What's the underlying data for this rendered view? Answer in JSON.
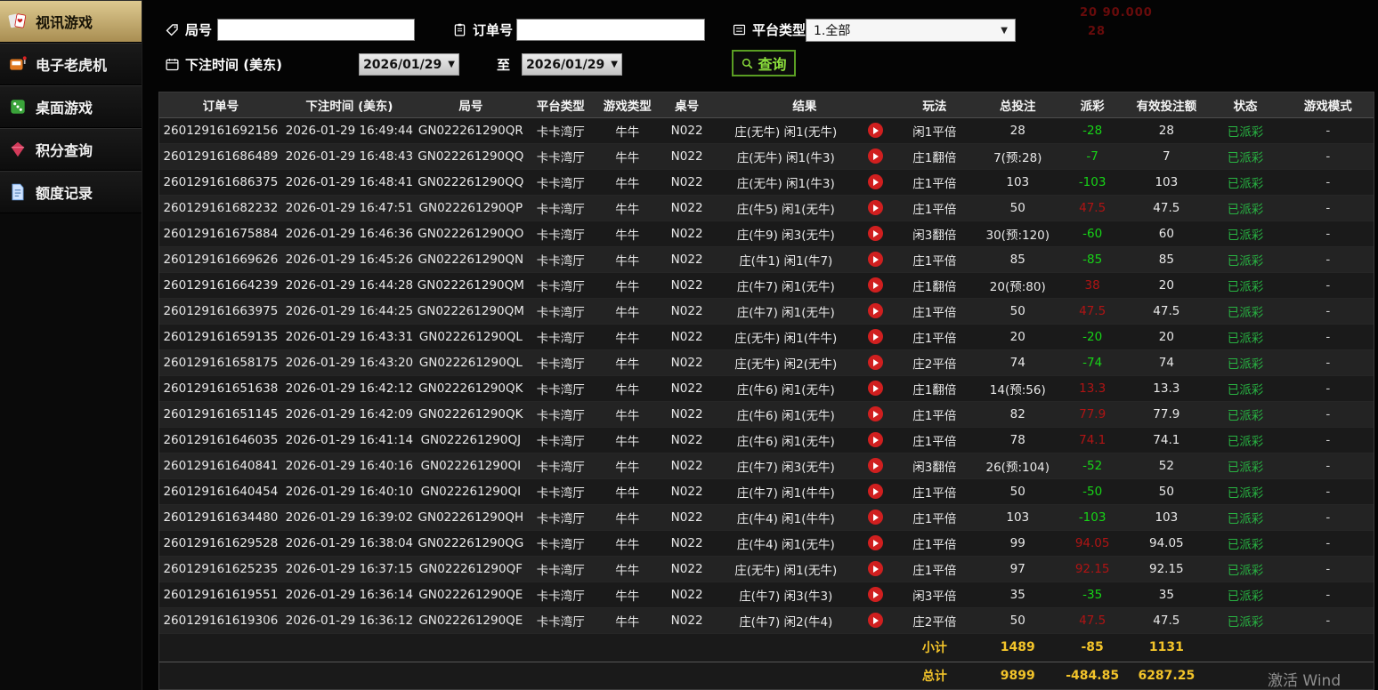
{
  "sidebar": {
    "items": [
      {
        "label": "视讯游戏",
        "active": true
      },
      {
        "label": "电子老虎机",
        "active": false
      },
      {
        "label": "桌面游戏",
        "active": false
      },
      {
        "label": "积分查询",
        "active": false
      },
      {
        "label": "额度记录",
        "active": false
      }
    ]
  },
  "filters": {
    "round_label": "局号",
    "round_value": "",
    "order_label": "订单号",
    "order_value": "",
    "platform_label": "平台类型",
    "platform_value": "1.全部",
    "bet_time_label": "下注时间 (美东)",
    "date_from": "2026/01/29",
    "to_label": "至",
    "date_to": "2026/01/29",
    "search_label": "查询"
  },
  "table": {
    "headers": [
      "订单号",
      "下注时间 (美东)",
      "局号",
      "平台类型",
      "游戏类型",
      "桌号",
      "结果",
      "玩法",
      "总投注",
      "派彩",
      "有效投注额",
      "状态",
      "游戏模式"
    ],
    "rows": [
      {
        "order_id": "260129161692156",
        "bet_time": "2026-01-29 16:49:44",
        "round_id": "GN022261290QR",
        "platform": "卡卡湾厅",
        "game_type": "牛牛",
        "table_no": "N022",
        "result": "庄(无牛) 闲1(无牛)",
        "play_type": "闲1平倍",
        "total_bet": "28",
        "payout": "-28",
        "payout_color": "green",
        "valid_bet": "28",
        "status": "已派彩",
        "mode": "-"
      },
      {
        "order_id": "260129161686489",
        "bet_time": "2026-01-29 16:48:43",
        "round_id": "GN022261290QQ",
        "platform": "卡卡湾厅",
        "game_type": "牛牛",
        "table_no": "N022",
        "result": "庄(无牛) 闲1(牛3)",
        "play_type": "庄1翻倍",
        "total_bet": "7(预:28)",
        "payout": "-7",
        "payout_color": "green",
        "valid_bet": "7",
        "status": "已派彩",
        "mode": "-"
      },
      {
        "order_id": "260129161686375",
        "bet_time": "2026-01-29 16:48:41",
        "round_id": "GN022261290QQ",
        "platform": "卡卡湾厅",
        "game_type": "牛牛",
        "table_no": "N022",
        "result": "庄(无牛) 闲1(牛3)",
        "play_type": "庄1平倍",
        "total_bet": "103",
        "payout": "-103",
        "payout_color": "green",
        "valid_bet": "103",
        "status": "已派彩",
        "mode": "-"
      },
      {
        "order_id": "260129161682232",
        "bet_time": "2026-01-29 16:47:51",
        "round_id": "GN022261290QP",
        "platform": "卡卡湾厅",
        "game_type": "牛牛",
        "table_no": "N022",
        "result": "庄(牛5) 闲1(无牛)",
        "play_type": "庄1平倍",
        "total_bet": "50",
        "payout": "47.5",
        "payout_color": "red",
        "valid_bet": "47.5",
        "status": "已派彩",
        "mode": "-"
      },
      {
        "order_id": "260129161675884",
        "bet_time": "2026-01-29 16:46:36",
        "round_id": "GN022261290QO",
        "platform": "卡卡湾厅",
        "game_type": "牛牛",
        "table_no": "N022",
        "result": "庄(牛9) 闲3(无牛)",
        "play_type": "闲3翻倍",
        "total_bet": "30(预:120)",
        "payout": "-60",
        "payout_color": "green",
        "valid_bet": "60",
        "status": "已派彩",
        "mode": "-"
      },
      {
        "order_id": "260129161669626",
        "bet_time": "2026-01-29 16:45:26",
        "round_id": "GN022261290QN",
        "platform": "卡卡湾厅",
        "game_type": "牛牛",
        "table_no": "N022",
        "result": "庄(牛1) 闲1(牛7)",
        "play_type": "庄1平倍",
        "total_bet": "85",
        "payout": "-85",
        "payout_color": "green",
        "valid_bet": "85",
        "status": "已派彩",
        "mode": "-"
      },
      {
        "order_id": "260129161664239",
        "bet_time": "2026-01-29 16:44:28",
        "round_id": "GN022261290QM",
        "platform": "卡卡湾厅",
        "game_type": "牛牛",
        "table_no": "N022",
        "result": "庄(牛7) 闲1(无牛)",
        "play_type": "庄1翻倍",
        "total_bet": "20(预:80)",
        "payout": "38",
        "payout_color": "red",
        "valid_bet": "20",
        "status": "已派彩",
        "mode": "-"
      },
      {
        "order_id": "260129161663975",
        "bet_time": "2026-01-29 16:44:25",
        "round_id": "GN022261290QM",
        "platform": "卡卡湾厅",
        "game_type": "牛牛",
        "table_no": "N022",
        "result": "庄(牛7) 闲1(无牛)",
        "play_type": "庄1平倍",
        "total_bet": "50",
        "payout": "47.5",
        "payout_color": "red",
        "valid_bet": "47.5",
        "status": "已派彩",
        "mode": "-"
      },
      {
        "order_id": "260129161659135",
        "bet_time": "2026-01-29 16:43:31",
        "round_id": "GN022261290QL",
        "platform": "卡卡湾厅",
        "game_type": "牛牛",
        "table_no": "N022",
        "result": "庄(无牛) 闲1(牛牛)",
        "play_type": "庄1平倍",
        "total_bet": "20",
        "payout": "-20",
        "payout_color": "green",
        "valid_bet": "20",
        "status": "已派彩",
        "mode": "-"
      },
      {
        "order_id": "260129161658175",
        "bet_time": "2026-01-29 16:43:20",
        "round_id": "GN022261290QL",
        "platform": "卡卡湾厅",
        "game_type": "牛牛",
        "table_no": "N022",
        "result": "庄(无牛) 闲2(无牛)",
        "play_type": "庄2平倍",
        "total_bet": "74",
        "payout": "-74",
        "payout_color": "green",
        "valid_bet": "74",
        "status": "已派彩",
        "mode": "-"
      },
      {
        "order_id": "260129161651638",
        "bet_time": "2026-01-29 16:42:12",
        "round_id": "GN022261290QK",
        "platform": "卡卡湾厅",
        "game_type": "牛牛",
        "table_no": "N022",
        "result": "庄(牛6) 闲1(无牛)",
        "play_type": "庄1翻倍",
        "total_bet": "14(预:56)",
        "payout": "13.3",
        "payout_color": "red",
        "valid_bet": "13.3",
        "status": "已派彩",
        "mode": "-"
      },
      {
        "order_id": "260129161651145",
        "bet_time": "2026-01-29 16:42:09",
        "round_id": "GN022261290QK",
        "platform": "卡卡湾厅",
        "game_type": "牛牛",
        "table_no": "N022",
        "result": "庄(牛6) 闲1(无牛)",
        "play_type": "庄1平倍",
        "total_bet": "82",
        "payout": "77.9",
        "payout_color": "red",
        "valid_bet": "77.9",
        "status": "已派彩",
        "mode": "-"
      },
      {
        "order_id": "260129161646035",
        "bet_time": "2026-01-29 16:41:14",
        "round_id": "GN022261290QJ",
        "platform": "卡卡湾厅",
        "game_type": "牛牛",
        "table_no": "N022",
        "result": "庄(牛6) 闲1(无牛)",
        "play_type": "庄1平倍",
        "total_bet": "78",
        "payout": "74.1",
        "payout_color": "red",
        "valid_bet": "74.1",
        "status": "已派彩",
        "mode": "-"
      },
      {
        "order_id": "260129161640841",
        "bet_time": "2026-01-29 16:40:16",
        "round_id": "GN022261290QI",
        "platform": "卡卡湾厅",
        "game_type": "牛牛",
        "table_no": "N022",
        "result": "庄(牛7) 闲3(无牛)",
        "play_type": "闲3翻倍",
        "total_bet": "26(预:104)",
        "payout": "-52",
        "payout_color": "green",
        "valid_bet": "52",
        "status": "已派彩",
        "mode": "-"
      },
      {
        "order_id": "260129161640454",
        "bet_time": "2026-01-29 16:40:10",
        "round_id": "GN022261290QI",
        "platform": "卡卡湾厅",
        "game_type": "牛牛",
        "table_no": "N022",
        "result": "庄(牛7) 闲1(牛牛)",
        "play_type": "庄1平倍",
        "total_bet": "50",
        "payout": "-50",
        "payout_color": "green",
        "valid_bet": "50",
        "status": "已派彩",
        "mode": "-"
      },
      {
        "order_id": "260129161634480",
        "bet_time": "2026-01-29 16:39:02",
        "round_id": "GN022261290QH",
        "platform": "卡卡湾厅",
        "game_type": "牛牛",
        "table_no": "N022",
        "result": "庄(牛4) 闲1(牛牛)",
        "play_type": "庄1平倍",
        "total_bet": "103",
        "payout": "-103",
        "payout_color": "green",
        "valid_bet": "103",
        "status": "已派彩",
        "mode": "-"
      },
      {
        "order_id": "260129161629528",
        "bet_time": "2026-01-29 16:38:04",
        "round_id": "GN022261290QG",
        "platform": "卡卡湾厅",
        "game_type": "牛牛",
        "table_no": "N022",
        "result": "庄(牛4) 闲1(无牛)",
        "play_type": "庄1平倍",
        "total_bet": "99",
        "payout": "94.05",
        "payout_color": "red",
        "valid_bet": "94.05",
        "status": "已派彩",
        "mode": "-"
      },
      {
        "order_id": "260129161625235",
        "bet_time": "2026-01-29 16:37:15",
        "round_id": "GN022261290QF",
        "platform": "卡卡湾厅",
        "game_type": "牛牛",
        "table_no": "N022",
        "result": "庄(无牛) 闲1(无牛)",
        "play_type": "庄1平倍",
        "total_bet": "97",
        "payout": "92.15",
        "payout_color": "red",
        "valid_bet": "92.15",
        "status": "已派彩",
        "mode": "-"
      },
      {
        "order_id": "260129161619551",
        "bet_time": "2026-01-29 16:36:14",
        "round_id": "GN022261290QE",
        "platform": "卡卡湾厅",
        "game_type": "牛牛",
        "table_no": "N022",
        "result": "庄(牛7) 闲3(牛3)",
        "play_type": "闲3平倍",
        "total_bet": "35",
        "payout": "-35",
        "payout_color": "green",
        "valid_bet": "35",
        "status": "已派彩",
        "mode": "-"
      },
      {
        "order_id": "260129161619306",
        "bet_time": "2026-01-29 16:36:12",
        "round_id": "GN022261290QE",
        "platform": "卡卡湾厅",
        "game_type": "牛牛",
        "table_no": "N022",
        "result": "庄(牛7) 闲2(牛4)",
        "play_type": "庄2平倍",
        "total_bet": "50",
        "payout": "47.5",
        "payout_color": "red",
        "valid_bet": "47.5",
        "status": "已派彩",
        "mode": "-"
      }
    ],
    "subtotal": {
      "label": "小计",
      "total_bet": "1489",
      "payout": "-85",
      "valid_bet": "1131"
    },
    "grand_total": {
      "label": "总计",
      "total_bet": "9899",
      "payout": "-484.85",
      "valid_bet": "6287.25"
    }
  },
  "background_noise": {
    "line1": "20  90.000",
    "line2": "28"
  },
  "watermark": "激活 Wind",
  "colors": {
    "active_tab_bg": "#c9ae74",
    "payout_negative_green": "#17d417",
    "payout_positive_red": "#b01414",
    "status_green": "#28b342",
    "summary_gold": "#f3c42a",
    "query_button_green": "#8ce03c",
    "replay_red": "#d01f1f"
  }
}
